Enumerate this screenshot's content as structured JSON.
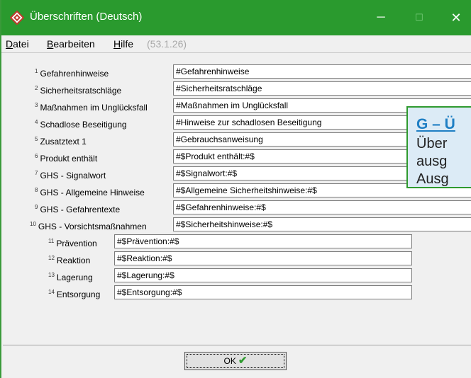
{
  "window": {
    "title": "Überschriften (Deutsch)",
    "controls": {
      "minimize": "─",
      "maximize": "☐",
      "close": "✕"
    }
  },
  "menu": {
    "items": [
      {
        "first": "D",
        "rest": "atei"
      },
      {
        "first": "B",
        "rest": "earbeiten"
      },
      {
        "first": "H",
        "rest": "ilfe"
      }
    ],
    "version": "(53.1.26)"
  },
  "fields": [
    {
      "num": "1",
      "label": "Gefahrenhinweise",
      "value": "#Gefahrenhinweise"
    },
    {
      "num": "2",
      "label": "Sicherheitsratschläge",
      "value": "#Sicherheitsratschläge"
    },
    {
      "num": "3",
      "label": "Maßnahmen im Unglücksfall",
      "value": "#Maßnahmen im Unglücksfall"
    },
    {
      "num": "4",
      "label": "Schadlose Beseitigung",
      "value": "#Hinweise zur schadlosen Beseitigung"
    },
    {
      "num": "5",
      "label": "Zusatztext 1",
      "value": "#Gebrauchsanweisung"
    },
    {
      "num": "6",
      "label": "Produkt enthält",
      "value": "#$Produkt enthält:#$"
    },
    {
      "num": "7",
      "label": "GHS - Signalwort",
      "value": "#$Signalwort:#$"
    },
    {
      "num": "8",
      "label": "GHS - Allgemeine Hinweise",
      "value": "#$Allgemeine Sicherheitshinweise:#$"
    },
    {
      "num": "9",
      "label": "GHS - Gefahrentexte",
      "value": "#$Gefahrenhinweise:#$"
    },
    {
      "num": "10",
      "label": "GHS - Vorsichtsmaßnahmen",
      "value": "#$Sicherheitshinweise:#$"
    },
    {
      "num": "11",
      "label": "Prävention",
      "value": "#$Prävention:#$"
    },
    {
      "num": "12",
      "label": "Reaktion",
      "value": "#$Reaktion:#$"
    },
    {
      "num": "13",
      "label": "Lagerung",
      "value": "#$Lagerung:#$"
    },
    {
      "num": "14",
      "label": "Entsorgung",
      "value": "#$Entsorgung:#$"
    }
  ],
  "ok_button": {
    "label": "OK",
    "icon": "✔"
  },
  "callout": {
    "heading": "G – Ü",
    "lines": [
      "Über",
      "ausg",
      "Ausg"
    ]
  },
  "colors": {
    "titlebar": "#2a9a2e",
    "callout_bg": "#dcebf6",
    "callout_border": "#2f9a2f",
    "callout_heading": "#1f7fc4"
  }
}
